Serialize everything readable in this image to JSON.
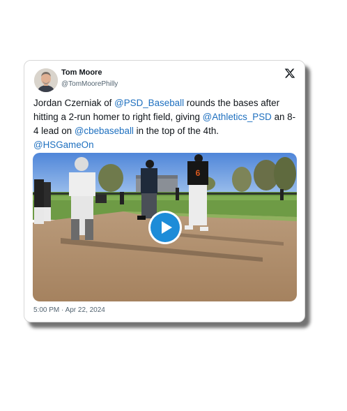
{
  "author": {
    "name": "Tom Moore",
    "handle": "@TomMoorePhilly"
  },
  "tweet": {
    "t1": "Jordan Czerniak of ",
    "m1": "@PSD_Baseball",
    "t2": " rounds the bases after hitting a 2-run homer to right field, giving ",
    "m2": "@Athletics_PSD",
    "t3": " an 8-4 lead on ",
    "m3": "@cbebaseball",
    "t4": " in the top of the 4th.",
    "m4": "@HSGameOn"
  },
  "media": {
    "jersey_number": "6"
  },
  "timestamp": "5:00 PM · Apr 22, 2024",
  "icons": {
    "platform": "x-logo-icon",
    "play": "play-icon"
  },
  "colors": {
    "mention": "#1d6fbf",
    "play": "#1d8cd8"
  }
}
